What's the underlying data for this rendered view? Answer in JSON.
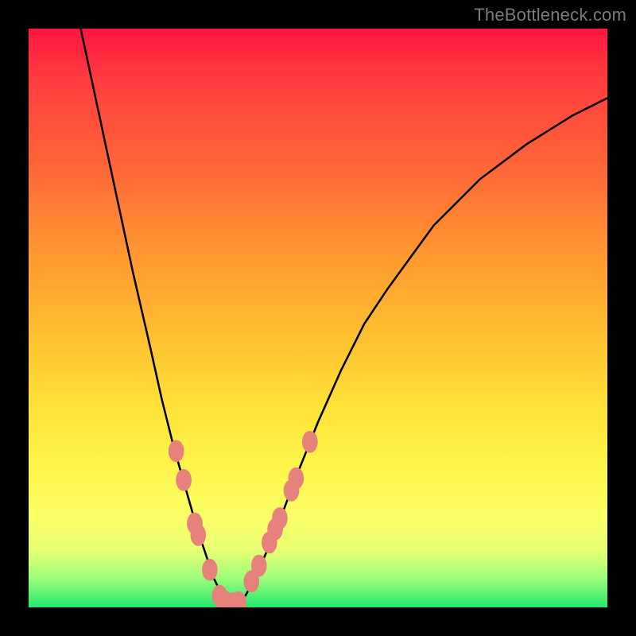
{
  "watermark": "TheBottleneck.com",
  "chart_data": {
    "type": "line",
    "title": "",
    "xlabel": "",
    "ylabel": "",
    "xlim": [
      0,
      100
    ],
    "ylim": [
      0,
      100
    ],
    "series": [
      {
        "name": "curve",
        "x": [
          9,
          12,
          15,
          18,
          21,
          23,
          25,
          27,
          29,
          31,
          32,
          33,
          34,
          35,
          36,
          37,
          38,
          40,
          43,
          46,
          50,
          54,
          58,
          62,
          70,
          78,
          86,
          94,
          100
        ],
        "y": [
          100,
          86,
          72,
          58,
          45,
          36,
          28,
          21,
          14,
          8,
          5,
          3,
          1.2,
          0.6,
          0.6,
          1.2,
          3,
          7,
          14,
          22,
          32,
          41,
          49,
          55,
          66,
          74,
          80,
          85,
          88
        ]
      }
    ],
    "markers": {
      "name": "beads",
      "points": [
        {
          "x": 25.5,
          "y": 27
        },
        {
          "x": 26.8,
          "y": 22
        },
        {
          "x": 28.7,
          "y": 14.5
        },
        {
          "x": 29.3,
          "y": 12.5
        },
        {
          "x": 31.3,
          "y": 6.5
        },
        {
          "x": 33.0,
          "y": 2.0
        },
        {
          "x": 33.8,
          "y": 1.1
        },
        {
          "x": 35.3,
          "y": 0.7
        },
        {
          "x": 36.3,
          "y": 0.9
        },
        {
          "x": 38.5,
          "y": 4.5
        },
        {
          "x": 39.8,
          "y": 7.2
        },
        {
          "x": 41.6,
          "y": 11.2
        },
        {
          "x": 42.6,
          "y": 13.5
        },
        {
          "x": 43.4,
          "y": 15.4
        },
        {
          "x": 45.4,
          "y": 20.2
        },
        {
          "x": 46.2,
          "y": 22.3
        },
        {
          "x": 48.6,
          "y": 28.6
        }
      ],
      "radius_x": 1.35,
      "radius_y": 1.9,
      "fill": "#e7817b"
    },
    "background_gradient": {
      "top": "#ff1640",
      "bottom": "#23e86f"
    }
  }
}
